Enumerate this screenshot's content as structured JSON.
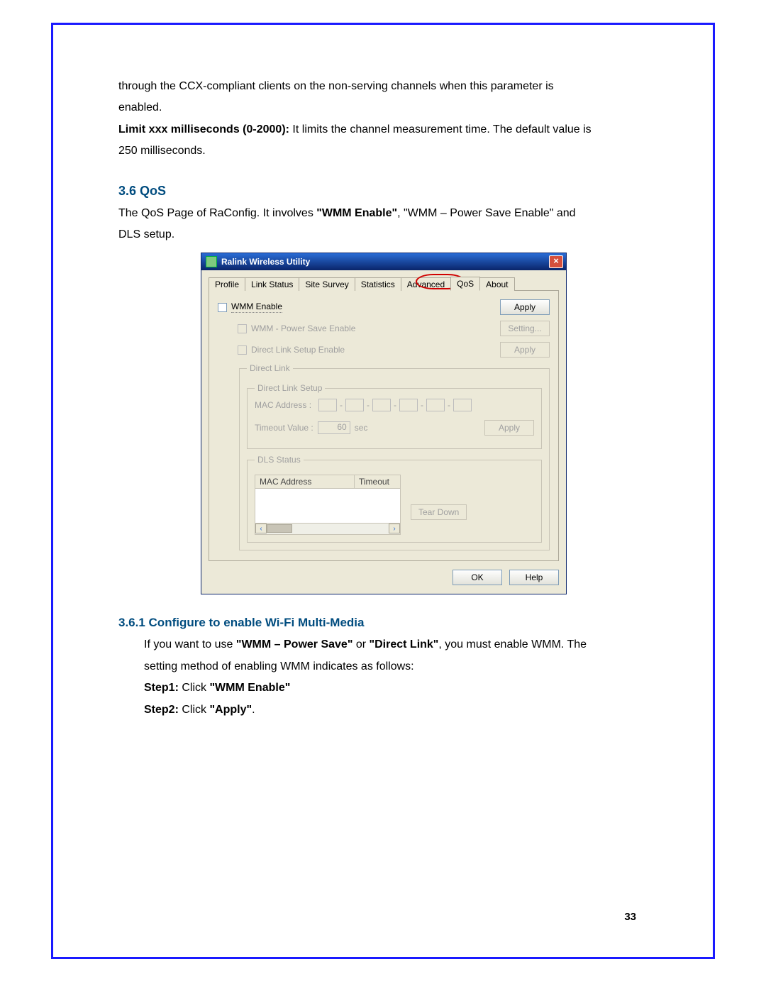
{
  "doc": {
    "para1_a": "through  the  CCX-compliant  clients  on  the  non-serving  channels  when  this  parameter  is",
    "para1_b": "enabled.",
    "limit_bold": "Limit xxx milliseconds (0-2000):",
    "limit_rest": " It limits the channel measurement time. The default value is",
    "limit_line2": "250 milliseconds.",
    "section_no": "3.6",
    "section_title": "QoS",
    "qos_para_a": "The QoS Page of RaConfig. It involves ",
    "qos_bold1": "\"WMM Enable\"",
    "qos_para_b": ", \"WMM – Power Save Enable\" and",
    "qos_para_c": "DLS setup.",
    "subsection": "3.6.1 Configure to enable Wi-Fi Multi-Media",
    "sub_p1_a": "If you want to use ",
    "sub_p1_b1": "\"WMM – Power Save\"",
    "sub_p1_mid": " or ",
    "sub_p1_b2": "\"Direct Link\"",
    "sub_p1_c": ", you must enable WMM. The",
    "sub_p2": "setting method of enabling WMM indicates as follows:",
    "step1_bold": "Step1:",
    "step1_rest": " Click ",
    "step1_q": "\"WMM Enable\"",
    "step2_bold": "Step2:",
    "step2_rest": " Click ",
    "step2_q": "\"Apply\"",
    "step2_dot": ".",
    "page_no": "33"
  },
  "window": {
    "title": "Ralink Wireless Utility",
    "close": "×",
    "tabs": [
      "Profile",
      "Link Status",
      "Site Survey",
      "Statistics",
      "Advanced",
      "QoS",
      "About"
    ],
    "active_tab_index": 5,
    "wmm_enable": "WMM Enable",
    "wmm_ps": "WMM - Power Save Enable",
    "dls_enable": "Direct Link Setup Enable",
    "direct_link": "Direct Link",
    "direct_link_setup": "Direct Link Setup",
    "mac_label": "MAC Address :",
    "timeout_label": "Timeout Value :",
    "timeout_value": "60",
    "timeout_unit": "sec",
    "dls_status": "DLS Status",
    "col_mac": "MAC Address",
    "col_timeout": "Timeout",
    "btn_apply": "Apply",
    "btn_setting": "Setting...",
    "btn_teardown": "Tear Down",
    "btn_ok": "OK",
    "btn_help": "Help",
    "scroll_left": "‹",
    "scroll_right": "›"
  }
}
